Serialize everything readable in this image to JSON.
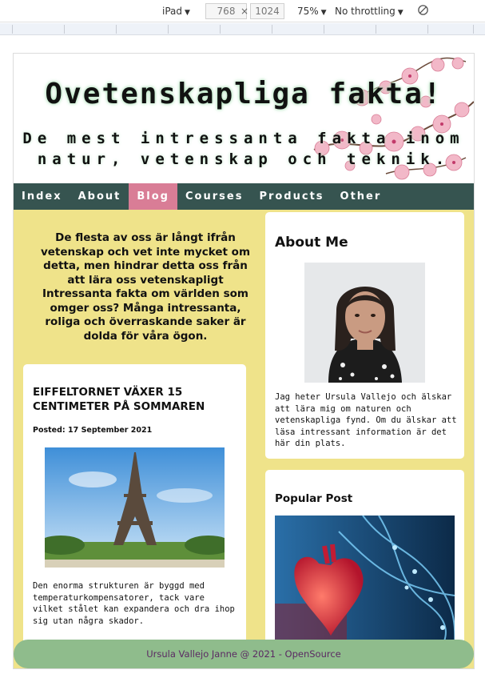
{
  "devtools": {
    "device": "iPad",
    "width": "768",
    "height": "1024",
    "zoom": "75%",
    "throttling": "No throttling",
    "rotate_icon": "rotate-icon"
  },
  "site": {
    "title": "Ovetenskapliga fakta!",
    "subtitle": "De mest intressanta fakta inom natur, vetenskap och teknik."
  },
  "nav": {
    "items": [
      {
        "label": "Index"
      },
      {
        "label": "About"
      },
      {
        "label": "Blog"
      },
      {
        "label": "Courses"
      },
      {
        "label": "Products"
      },
      {
        "label": "Other"
      }
    ],
    "active": "Blog"
  },
  "intro": "De flesta av oss är långt ifrån vetenskap och vet inte mycket om detta, men hindrar detta oss från att lära oss vetenskapligt Intressanta fakta om världen som omger oss? Många intressanta, roliga och överraskande saker är dolda för våra ögon.",
  "post": {
    "title": "EIFFELTORNET VÄXER 15 CENTIMETER PÅ SOMMAREN",
    "date": "Posted: 17 September 2021",
    "text": "Den enorma strukturen är byggd med temperaturkompensatorer, tack vare vilket stålet kan expandera och dra ihop sig utan några skador."
  },
  "about": {
    "title": "About Me",
    "text": "Jag heter Ursula Vallejo och älskar att lära mig om naturen och vetenskapliga fynd. Om du älskar att läsa intressant information är det här din plats."
  },
  "popular": {
    "title": "Popular Post"
  },
  "footer": "Ursula Vallejo Janne @ 2021 - OpenSource",
  "colors": {
    "nav_bg": "#365450",
    "nav_active": "#d97d96",
    "page_bg": "#efe38a",
    "footer_bg": "#8fbc8c",
    "footer_text": "#5b2a63"
  }
}
